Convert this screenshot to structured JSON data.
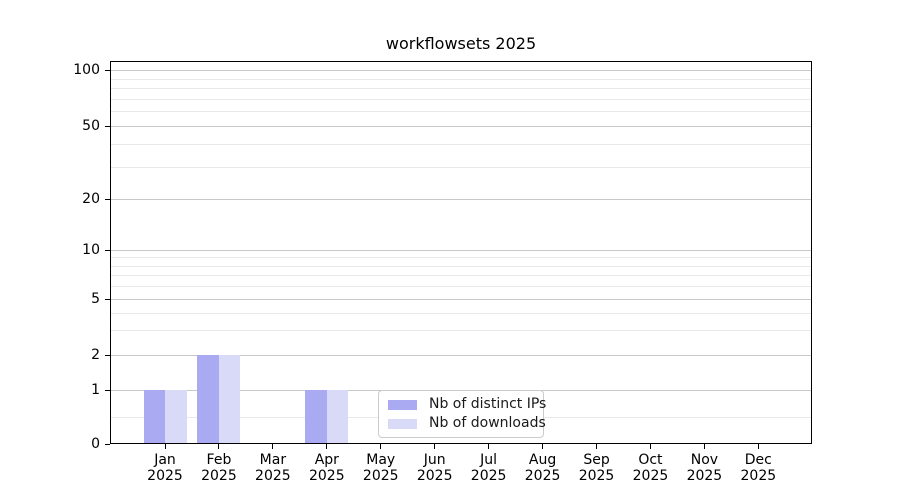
{
  "chart_data": {
    "type": "bar",
    "title": "workflowsets 2025",
    "categories": [
      "Jan",
      "Feb",
      "Mar",
      "Apr",
      "May",
      "Jun",
      "Jul",
      "Aug",
      "Sep",
      "Oct",
      "Nov",
      "Dec"
    ],
    "year_label": "2025",
    "series": [
      {
        "name": "Nb of distinct IPs",
        "color": "#aaaaf2",
        "values": [
          1,
          2,
          0,
          1,
          0,
          0,
          0,
          0,
          0,
          0,
          0,
          0
        ]
      },
      {
        "name": "Nb of downloads",
        "color": "#d9daf8",
        "values": [
          1,
          2,
          0,
          1,
          0,
          0,
          0,
          0,
          0,
          0,
          0,
          0
        ]
      }
    ],
    "xlabel": "",
    "ylabel": "",
    "y_ticks": [
      0,
      1,
      2,
      5,
      10,
      20,
      50,
      100
    ],
    "y_minor_gridlines": [
      0.5,
      3,
      4,
      6,
      7,
      8,
      9,
      30,
      40,
      60,
      70,
      80,
      90
    ],
    "y_scale": "log above 1, linear between 0 and 1",
    "ylim": [
      0,
      112
    ],
    "grid": "horizontal",
    "legend_position": "lower center inside plot",
    "colors": {
      "major_grid": "#c8c8c8",
      "minor_grid": "#e9e9e9",
      "spine": "#000000",
      "text": "#000000",
      "legend_border": "#cbcbcb",
      "background": "#ffffff"
    }
  }
}
